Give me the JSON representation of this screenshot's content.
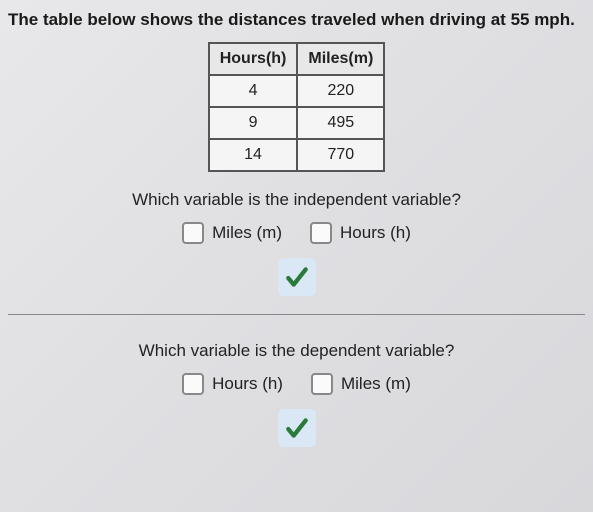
{
  "intro": "The table below shows the distances traveled when driving at 55 mph.",
  "table": {
    "headers": {
      "col1": "Hours(h)",
      "col2": "Miles(m)"
    },
    "rows": [
      {
        "h": "4",
        "m": "220"
      },
      {
        "h": "9",
        "m": "495"
      },
      {
        "h": "14",
        "m": "770"
      }
    ]
  },
  "q1": {
    "question": "Which variable is the independent variable?",
    "opt1": "Miles (m)",
    "opt2": "Hours (h)"
  },
  "q2": {
    "question": "Which variable is the dependent variable?",
    "opt1": "Hours (h)",
    "opt2": "Miles (m)"
  },
  "chart_data": {
    "type": "table",
    "title": "Distances traveled when driving at 55 mph",
    "columns": [
      "Hours(h)",
      "Miles(m)"
    ],
    "rows": [
      [
        4,
        220
      ],
      [
        9,
        495
      ],
      [
        14,
        770
      ]
    ]
  }
}
